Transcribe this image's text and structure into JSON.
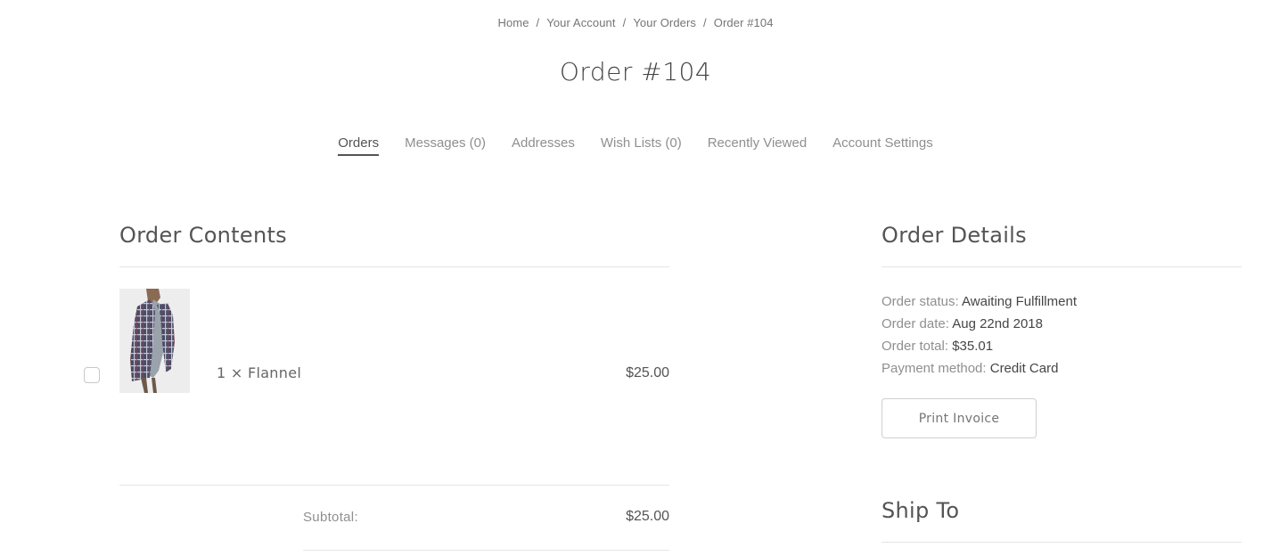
{
  "breadcrumbs": [
    {
      "label": "Home"
    },
    {
      "label": "Your Account"
    },
    {
      "label": "Your Orders"
    },
    {
      "label": "Order #104"
    }
  ],
  "breadcrumb_separator": "/",
  "page_title": "Order #104",
  "account_nav": [
    {
      "label": "Orders",
      "active": true
    },
    {
      "label": "Messages (0)",
      "active": false
    },
    {
      "label": "Addresses",
      "active": false
    },
    {
      "label": "Wish Lists (0)",
      "active": false
    },
    {
      "label": "Recently Viewed",
      "active": false
    },
    {
      "label": "Account Settings",
      "active": false
    }
  ],
  "order_contents": {
    "title": "Order Contents",
    "items": [
      {
        "quantity_name": "1 × Flannel",
        "price": "$25.00",
        "checked": false,
        "image_alt": "Flannel shirt product photo"
      }
    ],
    "subtotal_label": "Subtotal:",
    "subtotal_value": "$25.00"
  },
  "order_details": {
    "title": "Order Details",
    "fields": [
      {
        "label": "Order status:",
        "value": "Awaiting Fulfillment"
      },
      {
        "label": "Order date:",
        "value": "Aug 22nd 2018"
      },
      {
        "label": "Order total:",
        "value": "$35.01"
      },
      {
        "label": "Payment method:",
        "value": "Credit Card"
      }
    ],
    "print_button": "Print Invoice"
  },
  "ship_to": {
    "title": "Ship To"
  }
}
